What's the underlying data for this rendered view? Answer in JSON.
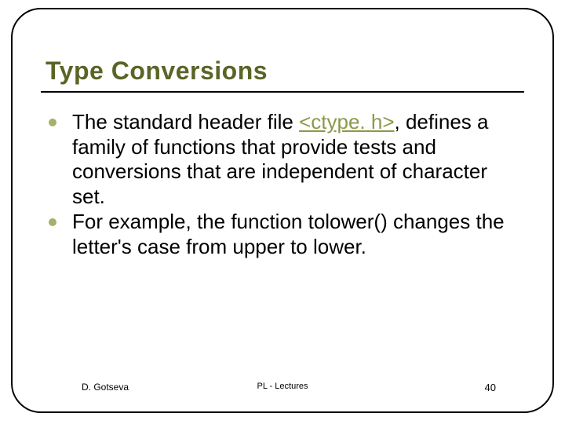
{
  "title": "Type Conversions",
  "bullets": [
    {
      "pre": "The standard header file ",
      "link": "<ctype. h>",
      "post": ", defines a family of functions that provide tests and conversions that are independent of character set."
    },
    {
      "pre": "For example, the function tolower() changes the letter's case from upper to lower.",
      "link": "",
      "post": ""
    }
  ],
  "footer": {
    "author": "D. Gotseva",
    "center": "PL - Lectures",
    "page": "40"
  }
}
